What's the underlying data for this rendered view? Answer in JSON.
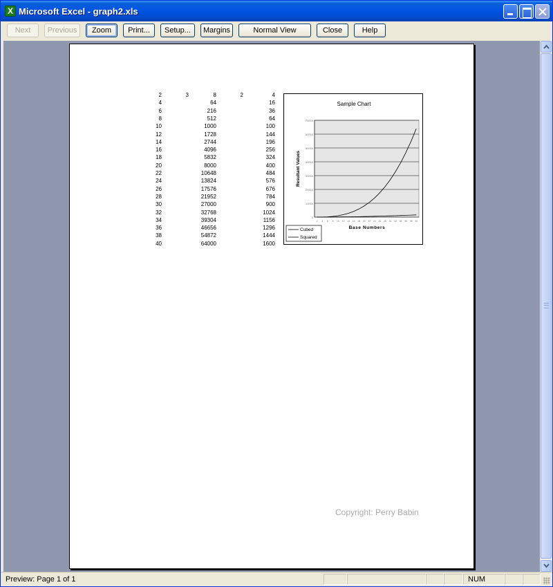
{
  "window": {
    "title": "Microsoft Excel - graph2.xls"
  },
  "toolbar": {
    "buttons": [
      {
        "label": "Next",
        "enabled": false
      },
      {
        "label": "Previous",
        "enabled": false
      },
      {
        "label": "Zoom",
        "enabled": true
      },
      {
        "label": "Print...",
        "enabled": true
      },
      {
        "label": "Setup...",
        "enabled": true
      },
      {
        "label": "Margins",
        "enabled": true
      },
      {
        "label": "Normal View",
        "enabled": true
      },
      {
        "label": "Close",
        "enabled": true
      },
      {
        "label": "Help",
        "enabled": true
      }
    ]
  },
  "sheet": {
    "rows": [
      [
        "2",
        "3",
        "8",
        "2",
        "4"
      ],
      [
        "4",
        "",
        "64",
        "",
        "16"
      ],
      [
        "6",
        "",
        "216",
        "",
        "36"
      ],
      [
        "8",
        "",
        "512",
        "",
        "64"
      ],
      [
        "10",
        "",
        "1000",
        "",
        "100"
      ],
      [
        "12",
        "",
        "1728",
        "",
        "144"
      ],
      [
        "14",
        "",
        "2744",
        "",
        "196"
      ],
      [
        "16",
        "",
        "4096",
        "",
        "256"
      ],
      [
        "18",
        "",
        "5832",
        "",
        "324"
      ],
      [
        "20",
        "",
        "8000",
        "",
        "400"
      ],
      [
        "22",
        "",
        "10648",
        "",
        "484"
      ],
      [
        "24",
        "",
        "13824",
        "",
        "576"
      ],
      [
        "26",
        "",
        "17576",
        "",
        "676"
      ],
      [
        "28",
        "",
        "21952",
        "",
        "784"
      ],
      [
        "30",
        "",
        "27000",
        "",
        "900"
      ],
      [
        "32",
        "",
        "32768",
        "",
        "1024"
      ],
      [
        "34",
        "",
        "39304",
        "",
        "1156"
      ],
      [
        "36",
        "",
        "46656",
        "",
        "1296"
      ],
      [
        "38",
        "",
        "54872",
        "",
        "1444"
      ],
      [
        "40",
        "",
        "64000",
        "",
        "1600"
      ]
    ]
  },
  "chart_data": {
    "type": "line",
    "title": "Sample Chart",
    "xlabel": "Base Numbers",
    "ylabel": "Resultant Values",
    "categories": [
      "2",
      "4",
      "6",
      "8",
      "10",
      "12",
      "14",
      "16",
      "18",
      "20",
      "22",
      "24",
      "26",
      "28",
      "30",
      "32",
      "34",
      "36",
      "38",
      "40"
    ],
    "series": [
      {
        "name": "Cubed",
        "values": [
          8,
          64,
          216,
          512,
          1000,
          1728,
          2744,
          4096,
          5832,
          8000,
          10648,
          13824,
          17576,
          21952,
          27000,
          32768,
          39304,
          46656,
          54872,
          64000
        ]
      },
      {
        "name": "Squared",
        "values": [
          4,
          16,
          36,
          64,
          100,
          144,
          196,
          256,
          324,
          400,
          484,
          576,
          676,
          784,
          900,
          1024,
          1156,
          1296,
          1444,
          1600
        ]
      }
    ],
    "ylim": [
      0,
      70000
    ],
    "yticks": [
      "0",
      "10000",
      "20000",
      "30000",
      "40000",
      "50000",
      "60000",
      "70000"
    ],
    "plot_background": "#e6e6e6",
    "grid": true,
    "legend_position": "bottom-left"
  },
  "watermark": "Copyright: Perry Babin",
  "status": {
    "text": "Preview: Page 1 of 1",
    "num": "NUM"
  },
  "colors": {
    "titlebar": "#0054e3",
    "workspace": "#8f98ae"
  }
}
